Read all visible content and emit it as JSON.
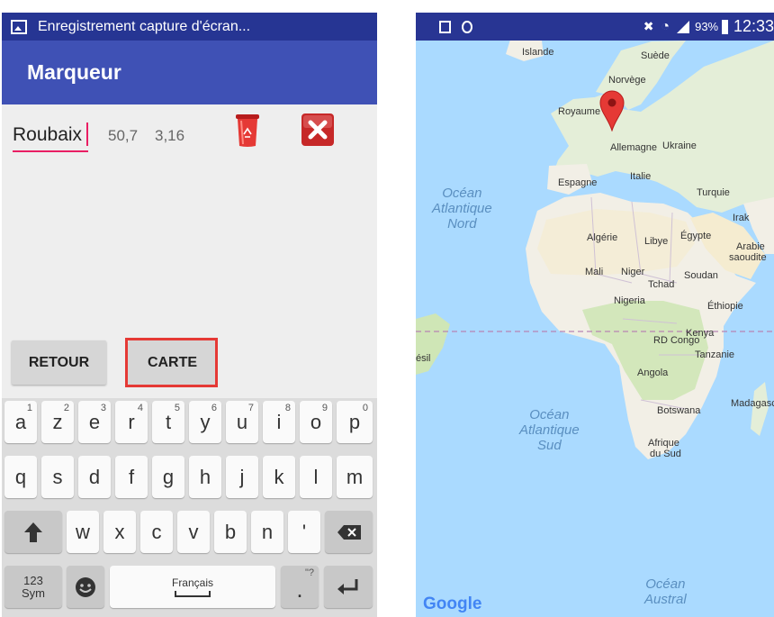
{
  "left_screen": {
    "status_title": "Enregistrement capture d'écran...",
    "app_title": "Marqueur",
    "marker": {
      "name": "Roubaix",
      "lat": "50,7",
      "lng": "3,16"
    },
    "buttons": {
      "back": "RETOUR",
      "map": "CARTE"
    },
    "keyboard": {
      "row1": [
        {
          "k": "a",
          "n": "1"
        },
        {
          "k": "z",
          "n": "2"
        },
        {
          "k": "e",
          "n": "3"
        },
        {
          "k": "r",
          "n": "4"
        },
        {
          "k": "t",
          "n": "5"
        },
        {
          "k": "y",
          "n": "6"
        },
        {
          "k": "u",
          "n": "7"
        },
        {
          "k": "i",
          "n": "8"
        },
        {
          "k": "o",
          "n": "9"
        },
        {
          "k": "p",
          "n": "0"
        }
      ],
      "row2": [
        "q",
        "s",
        "d",
        "f",
        "g",
        "h",
        "j",
        "k",
        "l",
        "m"
      ],
      "row3": [
        "w",
        "x",
        "c",
        "v",
        "b",
        "n",
        "'"
      ],
      "sym_line1": "123",
      "sym_line2": "Sym",
      "space_label": "Français",
      "period": ".",
      "period_alt": "\"?"
    }
  },
  "right_screen": {
    "status": {
      "battery": "93%",
      "time": "12:33"
    },
    "map_labels": {
      "islande": "Islande",
      "suede": "Suède",
      "norvege": "Norvège",
      "royaume": "Royaume",
      "allemagne": "Allemagne",
      "ukraine": "Ukraine",
      "espagne": "Espagne",
      "italie": "Italie",
      "turquie": "Turquie",
      "irak": "Irak",
      "algerie": "Algérie",
      "libye": "Libye",
      "egypte": "Égypte",
      "arabie1": "Arabie",
      "arabie2": "saoudite",
      "mali": "Mali",
      "niger": "Niger",
      "soudan": "Soudan",
      "tchad": "Tchad",
      "nigeria": "Nigeria",
      "ethiopie": "Éthiopie",
      "kenya": "Kenya",
      "rdcongo": "RD Congo",
      "tanzanie": "Tanzanie",
      "bresil": "ésil",
      "angola": "Angola",
      "madagascar": "Madagasc",
      "botswana": "Botswana",
      "afrique1": "Afrique",
      "afrique2": "du Sud"
    },
    "oceans": {
      "atl_nord": [
        "Océan",
        "Atlantique",
        "Nord"
      ],
      "atl_sud": [
        "Océan",
        "Atlantique",
        "Sud"
      ],
      "austral": [
        "Océan",
        "Austral"
      ]
    },
    "google": "Google"
  },
  "colors": {
    "app_bar": "#3f51b5",
    "status_bar": "#263593",
    "accent": "#e91e63",
    "highlight": "#e53935",
    "marker": "#e53935",
    "water": "#aadaff",
    "land": "#f2efe6"
  }
}
